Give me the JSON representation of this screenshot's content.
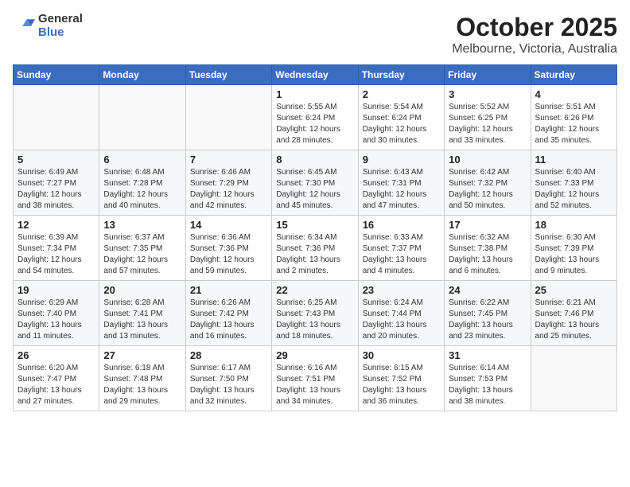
{
  "header": {
    "logo_general": "General",
    "logo_blue": "Blue",
    "month": "October 2025",
    "location": "Melbourne, Victoria, Australia"
  },
  "weekdays": [
    "Sunday",
    "Monday",
    "Tuesday",
    "Wednesday",
    "Thursday",
    "Friday",
    "Saturday"
  ],
  "weeks": [
    [
      {
        "day": "",
        "info": ""
      },
      {
        "day": "",
        "info": ""
      },
      {
        "day": "",
        "info": ""
      },
      {
        "day": "1",
        "info": "Sunrise: 5:55 AM\nSunset: 6:24 PM\nDaylight: 12 hours\nand 28 minutes."
      },
      {
        "day": "2",
        "info": "Sunrise: 5:54 AM\nSunset: 6:24 PM\nDaylight: 12 hours\nand 30 minutes."
      },
      {
        "day": "3",
        "info": "Sunrise: 5:52 AM\nSunset: 6:25 PM\nDaylight: 12 hours\nand 33 minutes."
      },
      {
        "day": "4",
        "info": "Sunrise: 5:51 AM\nSunset: 6:26 PM\nDaylight: 12 hours\nand 35 minutes."
      }
    ],
    [
      {
        "day": "5",
        "info": "Sunrise: 6:49 AM\nSunset: 7:27 PM\nDaylight: 12 hours\nand 38 minutes."
      },
      {
        "day": "6",
        "info": "Sunrise: 6:48 AM\nSunset: 7:28 PM\nDaylight: 12 hours\nand 40 minutes."
      },
      {
        "day": "7",
        "info": "Sunrise: 6:46 AM\nSunset: 7:29 PM\nDaylight: 12 hours\nand 42 minutes."
      },
      {
        "day": "8",
        "info": "Sunrise: 6:45 AM\nSunset: 7:30 PM\nDaylight: 12 hours\nand 45 minutes."
      },
      {
        "day": "9",
        "info": "Sunrise: 6:43 AM\nSunset: 7:31 PM\nDaylight: 12 hours\nand 47 minutes."
      },
      {
        "day": "10",
        "info": "Sunrise: 6:42 AM\nSunset: 7:32 PM\nDaylight: 12 hours\nand 50 minutes."
      },
      {
        "day": "11",
        "info": "Sunrise: 6:40 AM\nSunset: 7:33 PM\nDaylight: 12 hours\nand 52 minutes."
      }
    ],
    [
      {
        "day": "12",
        "info": "Sunrise: 6:39 AM\nSunset: 7:34 PM\nDaylight: 12 hours\nand 54 minutes."
      },
      {
        "day": "13",
        "info": "Sunrise: 6:37 AM\nSunset: 7:35 PM\nDaylight: 12 hours\nand 57 minutes."
      },
      {
        "day": "14",
        "info": "Sunrise: 6:36 AM\nSunset: 7:36 PM\nDaylight: 12 hours\nand 59 minutes."
      },
      {
        "day": "15",
        "info": "Sunrise: 6:34 AM\nSunset: 7:36 PM\nDaylight: 13 hours\nand 2 minutes."
      },
      {
        "day": "16",
        "info": "Sunrise: 6:33 AM\nSunset: 7:37 PM\nDaylight: 13 hours\nand 4 minutes."
      },
      {
        "day": "17",
        "info": "Sunrise: 6:32 AM\nSunset: 7:38 PM\nDaylight: 13 hours\nand 6 minutes."
      },
      {
        "day": "18",
        "info": "Sunrise: 6:30 AM\nSunset: 7:39 PM\nDaylight: 13 hours\nand 9 minutes."
      }
    ],
    [
      {
        "day": "19",
        "info": "Sunrise: 6:29 AM\nSunset: 7:40 PM\nDaylight: 13 hours\nand 11 minutes."
      },
      {
        "day": "20",
        "info": "Sunrise: 6:28 AM\nSunset: 7:41 PM\nDaylight: 13 hours\nand 13 minutes."
      },
      {
        "day": "21",
        "info": "Sunrise: 6:26 AM\nSunset: 7:42 PM\nDaylight: 13 hours\nand 16 minutes."
      },
      {
        "day": "22",
        "info": "Sunrise: 6:25 AM\nSunset: 7:43 PM\nDaylight: 13 hours\nand 18 minutes."
      },
      {
        "day": "23",
        "info": "Sunrise: 6:24 AM\nSunset: 7:44 PM\nDaylight: 13 hours\nand 20 minutes."
      },
      {
        "day": "24",
        "info": "Sunrise: 6:22 AM\nSunset: 7:45 PM\nDaylight: 13 hours\nand 23 minutes."
      },
      {
        "day": "25",
        "info": "Sunrise: 6:21 AM\nSunset: 7:46 PM\nDaylight: 13 hours\nand 25 minutes."
      }
    ],
    [
      {
        "day": "26",
        "info": "Sunrise: 6:20 AM\nSunset: 7:47 PM\nDaylight: 13 hours\nand 27 minutes."
      },
      {
        "day": "27",
        "info": "Sunrise: 6:18 AM\nSunset: 7:48 PM\nDaylight: 13 hours\nand 29 minutes."
      },
      {
        "day": "28",
        "info": "Sunrise: 6:17 AM\nSunset: 7:50 PM\nDaylight: 13 hours\nand 32 minutes."
      },
      {
        "day": "29",
        "info": "Sunrise: 6:16 AM\nSunset: 7:51 PM\nDaylight: 13 hours\nand 34 minutes."
      },
      {
        "day": "30",
        "info": "Sunrise: 6:15 AM\nSunset: 7:52 PM\nDaylight: 13 hours\nand 36 minutes."
      },
      {
        "day": "31",
        "info": "Sunrise: 6:14 AM\nSunset: 7:53 PM\nDaylight: 13 hours\nand 38 minutes."
      },
      {
        "day": "",
        "info": ""
      }
    ]
  ]
}
